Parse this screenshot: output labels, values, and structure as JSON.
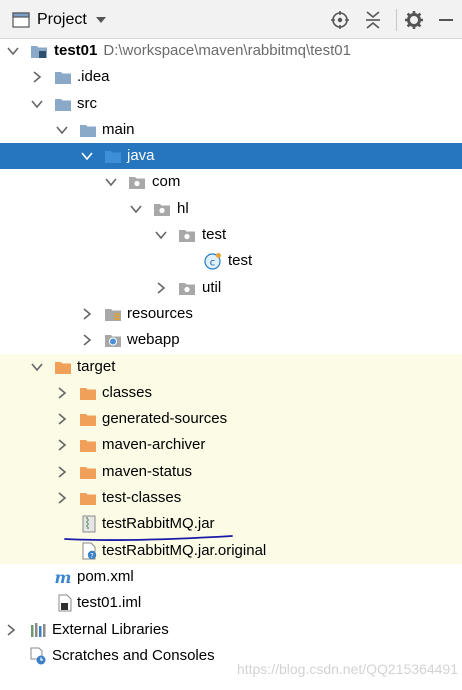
{
  "toolbar": {
    "title": "Project",
    "icons": [
      "project-window-icon",
      "dropdown-caret-icon",
      "locate-icon",
      "collapse-all-icon",
      "settings-gear-icon",
      "hide-icon"
    ]
  },
  "tree": {
    "root": {
      "name": "test01",
      "path": "D:\\workspace\\maven\\rabbitmq\\test01"
    },
    "idea": ".idea",
    "src": "src",
    "main": "main",
    "java": "java",
    "com": "com",
    "hl": "hl",
    "test_pkg": "test",
    "test_class": "test",
    "util": "util",
    "resources": "resources",
    "webapp": "webapp",
    "target": "target",
    "classes": "classes",
    "generated_sources": "generated-sources",
    "maven_archiver": "maven-archiver",
    "maven_status": "maven-status",
    "test_classes": "test-classes",
    "jar": "testRabbitMQ.jar",
    "jar_original": "testRabbitMQ.jar.original",
    "pom": "pom.xml",
    "iml": "test01.iml",
    "external_libraries": "External Libraries",
    "scratches": "Scratches and Consoles"
  },
  "watermark": "https://blog.csdn.net/QQ215364491",
  "colors": {
    "selection": "#2675bf",
    "target_background": "#fcfbe6",
    "folder_blue": "#8aa9c9",
    "folder_orange": "#f0a058",
    "annotation_ink": "#1a1aa8"
  }
}
